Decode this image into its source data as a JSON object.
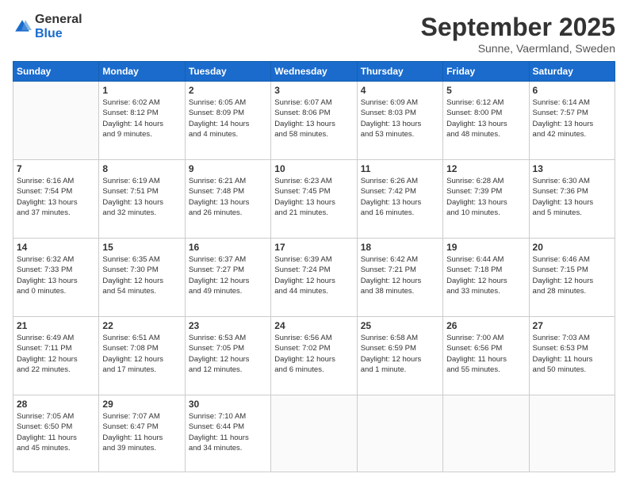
{
  "logo": {
    "general": "General",
    "blue": "Blue"
  },
  "header": {
    "month": "September 2025",
    "location": "Sunne, Vaermland, Sweden"
  },
  "weekdays": [
    "Sunday",
    "Monday",
    "Tuesday",
    "Wednesday",
    "Thursday",
    "Friday",
    "Saturday"
  ],
  "weeks": [
    [
      {
        "day": "",
        "info": ""
      },
      {
        "day": "1",
        "info": "Sunrise: 6:02 AM\nSunset: 8:12 PM\nDaylight: 14 hours\nand 9 minutes."
      },
      {
        "day": "2",
        "info": "Sunrise: 6:05 AM\nSunset: 8:09 PM\nDaylight: 14 hours\nand 4 minutes."
      },
      {
        "day": "3",
        "info": "Sunrise: 6:07 AM\nSunset: 8:06 PM\nDaylight: 13 hours\nand 58 minutes."
      },
      {
        "day": "4",
        "info": "Sunrise: 6:09 AM\nSunset: 8:03 PM\nDaylight: 13 hours\nand 53 minutes."
      },
      {
        "day": "5",
        "info": "Sunrise: 6:12 AM\nSunset: 8:00 PM\nDaylight: 13 hours\nand 48 minutes."
      },
      {
        "day": "6",
        "info": "Sunrise: 6:14 AM\nSunset: 7:57 PM\nDaylight: 13 hours\nand 42 minutes."
      }
    ],
    [
      {
        "day": "7",
        "info": "Sunrise: 6:16 AM\nSunset: 7:54 PM\nDaylight: 13 hours\nand 37 minutes."
      },
      {
        "day": "8",
        "info": "Sunrise: 6:19 AM\nSunset: 7:51 PM\nDaylight: 13 hours\nand 32 minutes."
      },
      {
        "day": "9",
        "info": "Sunrise: 6:21 AM\nSunset: 7:48 PM\nDaylight: 13 hours\nand 26 minutes."
      },
      {
        "day": "10",
        "info": "Sunrise: 6:23 AM\nSunset: 7:45 PM\nDaylight: 13 hours\nand 21 minutes."
      },
      {
        "day": "11",
        "info": "Sunrise: 6:26 AM\nSunset: 7:42 PM\nDaylight: 13 hours\nand 16 minutes."
      },
      {
        "day": "12",
        "info": "Sunrise: 6:28 AM\nSunset: 7:39 PM\nDaylight: 13 hours\nand 10 minutes."
      },
      {
        "day": "13",
        "info": "Sunrise: 6:30 AM\nSunset: 7:36 PM\nDaylight: 13 hours\nand 5 minutes."
      }
    ],
    [
      {
        "day": "14",
        "info": "Sunrise: 6:32 AM\nSunset: 7:33 PM\nDaylight: 13 hours\nand 0 minutes."
      },
      {
        "day": "15",
        "info": "Sunrise: 6:35 AM\nSunset: 7:30 PM\nDaylight: 12 hours\nand 54 minutes."
      },
      {
        "day": "16",
        "info": "Sunrise: 6:37 AM\nSunset: 7:27 PM\nDaylight: 12 hours\nand 49 minutes."
      },
      {
        "day": "17",
        "info": "Sunrise: 6:39 AM\nSunset: 7:24 PM\nDaylight: 12 hours\nand 44 minutes."
      },
      {
        "day": "18",
        "info": "Sunrise: 6:42 AM\nSunset: 7:21 PM\nDaylight: 12 hours\nand 38 minutes."
      },
      {
        "day": "19",
        "info": "Sunrise: 6:44 AM\nSunset: 7:18 PM\nDaylight: 12 hours\nand 33 minutes."
      },
      {
        "day": "20",
        "info": "Sunrise: 6:46 AM\nSunset: 7:15 PM\nDaylight: 12 hours\nand 28 minutes."
      }
    ],
    [
      {
        "day": "21",
        "info": "Sunrise: 6:49 AM\nSunset: 7:11 PM\nDaylight: 12 hours\nand 22 minutes."
      },
      {
        "day": "22",
        "info": "Sunrise: 6:51 AM\nSunset: 7:08 PM\nDaylight: 12 hours\nand 17 minutes."
      },
      {
        "day": "23",
        "info": "Sunrise: 6:53 AM\nSunset: 7:05 PM\nDaylight: 12 hours\nand 12 minutes."
      },
      {
        "day": "24",
        "info": "Sunrise: 6:56 AM\nSunset: 7:02 PM\nDaylight: 12 hours\nand 6 minutes."
      },
      {
        "day": "25",
        "info": "Sunrise: 6:58 AM\nSunset: 6:59 PM\nDaylight: 12 hours\nand 1 minute."
      },
      {
        "day": "26",
        "info": "Sunrise: 7:00 AM\nSunset: 6:56 PM\nDaylight: 11 hours\nand 55 minutes."
      },
      {
        "day": "27",
        "info": "Sunrise: 7:03 AM\nSunset: 6:53 PM\nDaylight: 11 hours\nand 50 minutes."
      }
    ],
    [
      {
        "day": "28",
        "info": "Sunrise: 7:05 AM\nSunset: 6:50 PM\nDaylight: 11 hours\nand 45 minutes."
      },
      {
        "day": "29",
        "info": "Sunrise: 7:07 AM\nSunset: 6:47 PM\nDaylight: 11 hours\nand 39 minutes."
      },
      {
        "day": "30",
        "info": "Sunrise: 7:10 AM\nSunset: 6:44 PM\nDaylight: 11 hours\nand 34 minutes."
      },
      {
        "day": "",
        "info": ""
      },
      {
        "day": "",
        "info": ""
      },
      {
        "day": "",
        "info": ""
      },
      {
        "day": "",
        "info": ""
      }
    ]
  ]
}
